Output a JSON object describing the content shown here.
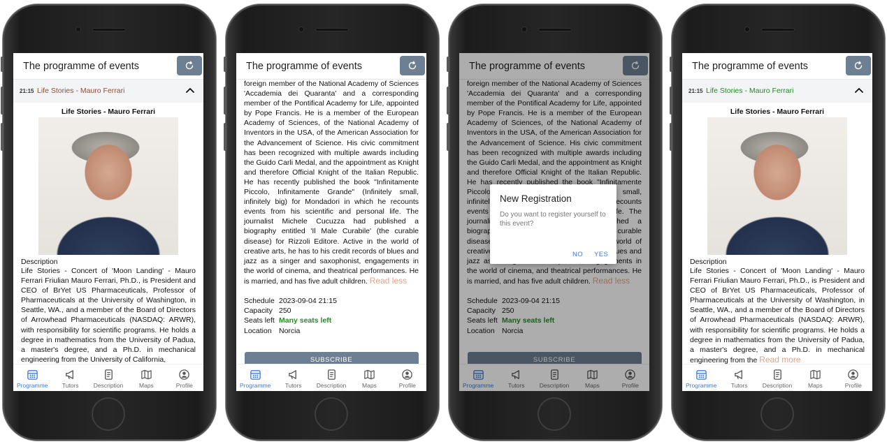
{
  "app": {
    "title": "The programme of events",
    "event_time": "21:15",
    "event_name": "Life Stories - Mauro Ferrari",
    "colors": {
      "event_link_brownish": "#8a4f37",
      "event_link_green": "#238a23",
      "primary": "#6d7f93",
      "accent_blue": "#3a7bd5",
      "green": "#2a8b2a",
      "read_link": "#e0a488"
    }
  },
  "detail": {
    "title": "Life Stories - Mauro Ferrari",
    "description_label": "Description",
    "desc_short": "Life Stories - Concert of 'Moon Landing' - Mauro Ferrari Friulian Mauro Ferrari, Ph.D., is President and CEO of BrYet US Pharmaceuticals, Professor of Pharmaceuticals at the University of Washington, in Seattle, WA., and a member of the Board of Directors of Arrowhead Pharmaceuticals (NASDAQ: ARWR), with responsibility for scientific programs. He holds a degree in mathematics from the University of Padua, a master's degree, and a Ph.D. in mechanical engineering from the University of California,",
    "desc_short_4": "Life Stories - Concert of 'Moon Landing' - Mauro Ferrari Friulian Mauro Ferrari, Ph.D., is President and CEO of BrYet US Pharmaceuticals, Professor of Pharmaceuticals at the University of Washington, in Seattle, WA., and a member of the Board of Directors of Arrowhead Pharmaceuticals (NASDAQ: ARWR), with responsibility for scientific programs. He holds a degree in mathematics from the University of Padua, a master's degree, and a Ph.D. in mechanical engineering from the",
    "read_more": "Read more",
    "desc_long": "foreign member of the National Academy of Sciences 'Accademia dei Quaranta' and a corresponding member of the Pontifical Academy for Life, appointed by Pope Francis. He is a member of the European Academy of Sciences, of the National Academy of Inventors in the USA, of the American Association for the Advancement of Science. His civic commitment has been recognized with multiple awards including the Guido Carli Medal, and the appointment as Knight and therefore Official Knight of the Italian Republic. He has recently published the book \"Infinitamente Piccolo, Infinitamente Grande\" (Infinitely small, infinitely big) for Mondadori in which he recounts events from his scientific and personal life. The journalist Michele Cucuzza had published a biography entitled 'Il Male Curabile' (the curable disease) for Rizzoli Editore. Active in the world of creative arts, he has to his credit records of blues and jazz as a singer and saxophonist, engagements in the world of cinema, and theatrical performances. He is married, and has five adult children.",
    "read_less": "Read less",
    "schedule": [
      {
        "key": "Schedule",
        "value": "2023-09-04 21:15"
      },
      {
        "key": "Capacity",
        "value": "250"
      },
      {
        "key": "Seats left",
        "value": "Many seats left"
      },
      {
        "key": "Location",
        "value": "Norcia"
      }
    ],
    "subscribe_label": "SUBSCRIBE"
  },
  "dialog": {
    "title": "New Registration",
    "message": "Do you want to register yourself to this event?",
    "no": "NO",
    "yes": "YES"
  },
  "tabs": [
    {
      "label": "Programme",
      "icon": "calendar-icon",
      "active": true
    },
    {
      "label": "Tutors",
      "icon": "megaphone-icon",
      "active": false
    },
    {
      "label": "Description",
      "icon": "document-icon",
      "active": false
    },
    {
      "label": "Maps",
      "icon": "map-icon",
      "active": false
    },
    {
      "label": "Profile",
      "icon": "profile-icon",
      "active": false
    }
  ]
}
